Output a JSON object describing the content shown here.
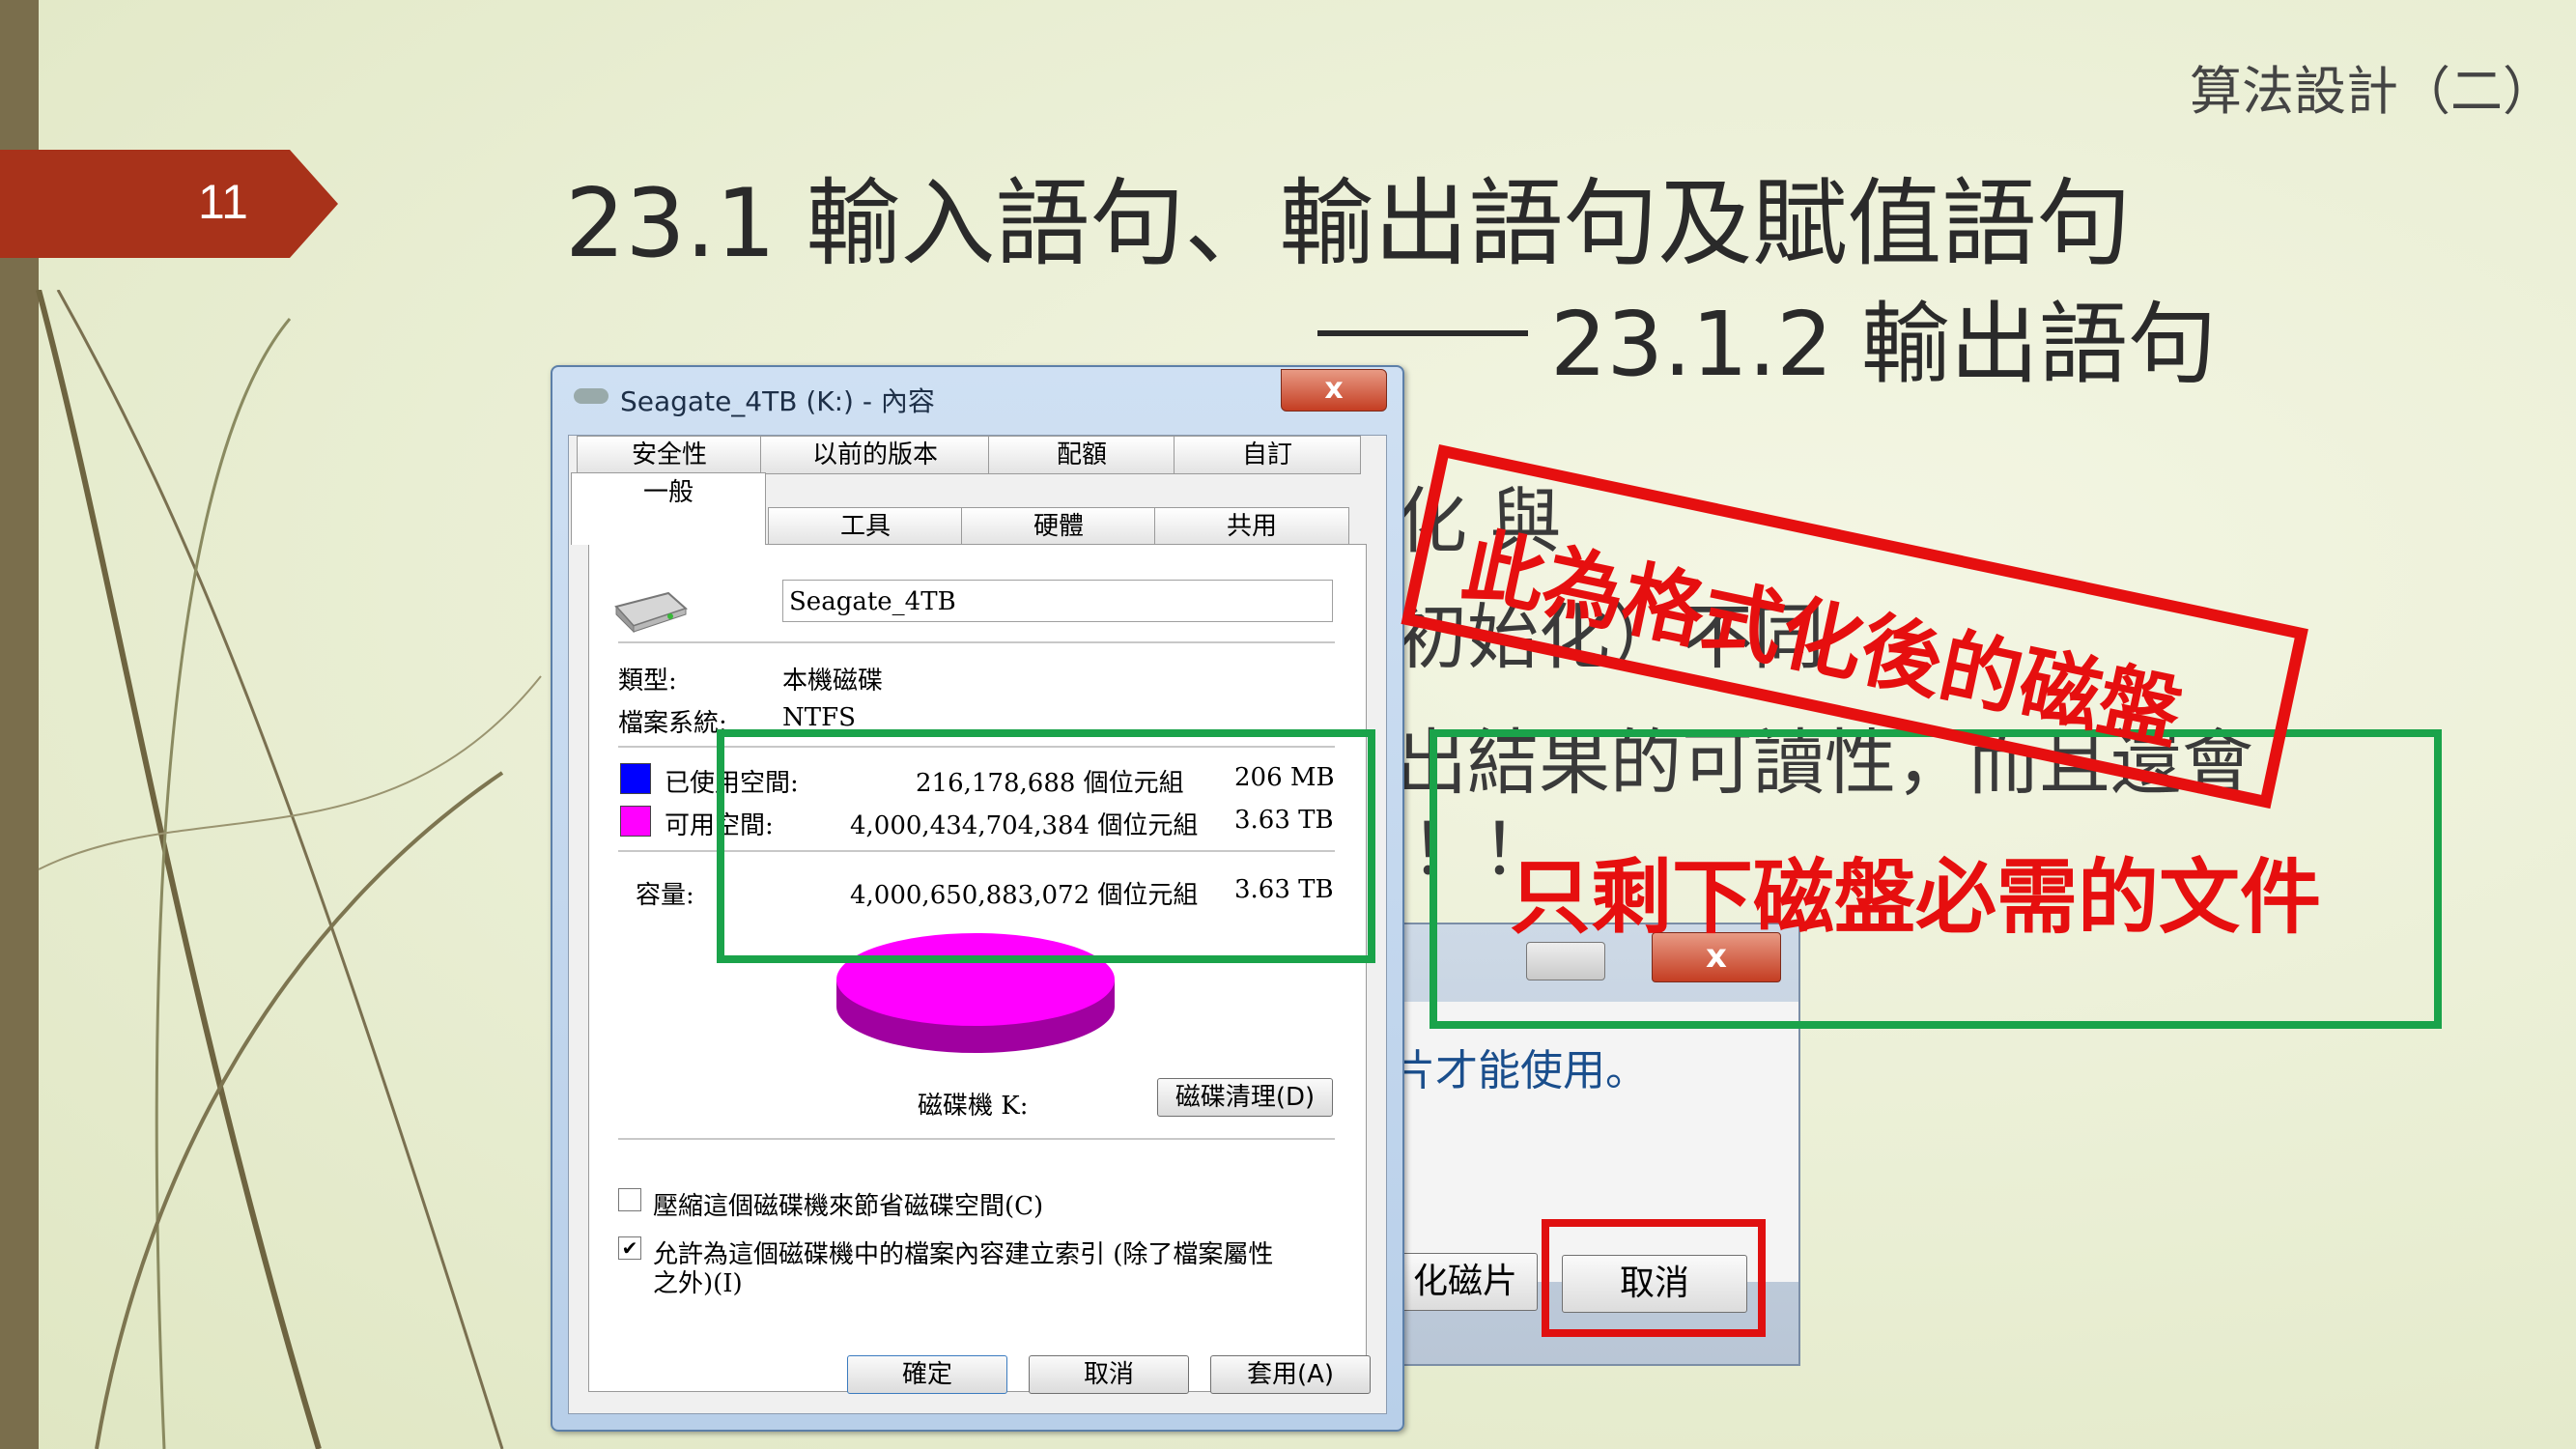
{
  "slide": {
    "header": "算法設計（二）",
    "page_number": "11",
    "title_line1": "23.1 輸入語句、輸出語句及賦值語句",
    "title_line2": "23.1.2 輸出語句"
  },
  "body_fragments": {
    "line1": "化 與",
    "line2": "初始化）不同",
    "line3": "出結果的可讀性，而且還會",
    "line4": "！！"
  },
  "properties_dialog": {
    "title": "Seagate_4TB (K:) - 內容",
    "close_label": "x",
    "tabs_row1": [
      "安全性",
      "以前的版本",
      "配額",
      "自訂"
    ],
    "tabs_row2": [
      "一般",
      "工具",
      "硬體",
      "共用"
    ],
    "drive_name": "Seagate_4TB",
    "type_label": "類型:",
    "type_value": "本機磁碟",
    "fs_label": "檔案系統:",
    "fs_value": "NTFS",
    "used_label": "已使用空間:",
    "used_bytes": "216,178,688 個位元組",
    "used_size": "206 MB",
    "free_label": "可用空間:",
    "free_bytes": "4,000,434,704,384 個位元組",
    "free_size": "3.63 TB",
    "capacity_label": "容量:",
    "capacity_bytes": "4,000,650,883,072 個位元組",
    "capacity_size": "3.63 TB",
    "drive_label": "磁碟機 K:",
    "cleanup_button": "磁碟清理(D)",
    "compress_label": "壓縮這個磁碟機來節省磁碟空間(C)",
    "compress_checked": false,
    "index_label": "允許為這個磁碟機中的檔案內容建立索引 (除了檔案屬性",
    "index_label2": "之外)(I)",
    "index_checked": true,
    "ok_button": "確定",
    "cancel_button": "取消",
    "apply_button": "套用(A)",
    "colors": {
      "used": "#0000ff",
      "free": "#ff00ff"
    }
  },
  "format_dialog": {
    "close_label": "x",
    "message": "片才能使用。",
    "button1": "化磁片",
    "button2": "取消"
  },
  "annotations": {
    "stamp_text": "此為格式化後的磁盤",
    "green_callout_text": "只剩下磁盤必需的文件",
    "colors": {
      "red": "#e60f0f",
      "green": "#1aa34a"
    }
  }
}
